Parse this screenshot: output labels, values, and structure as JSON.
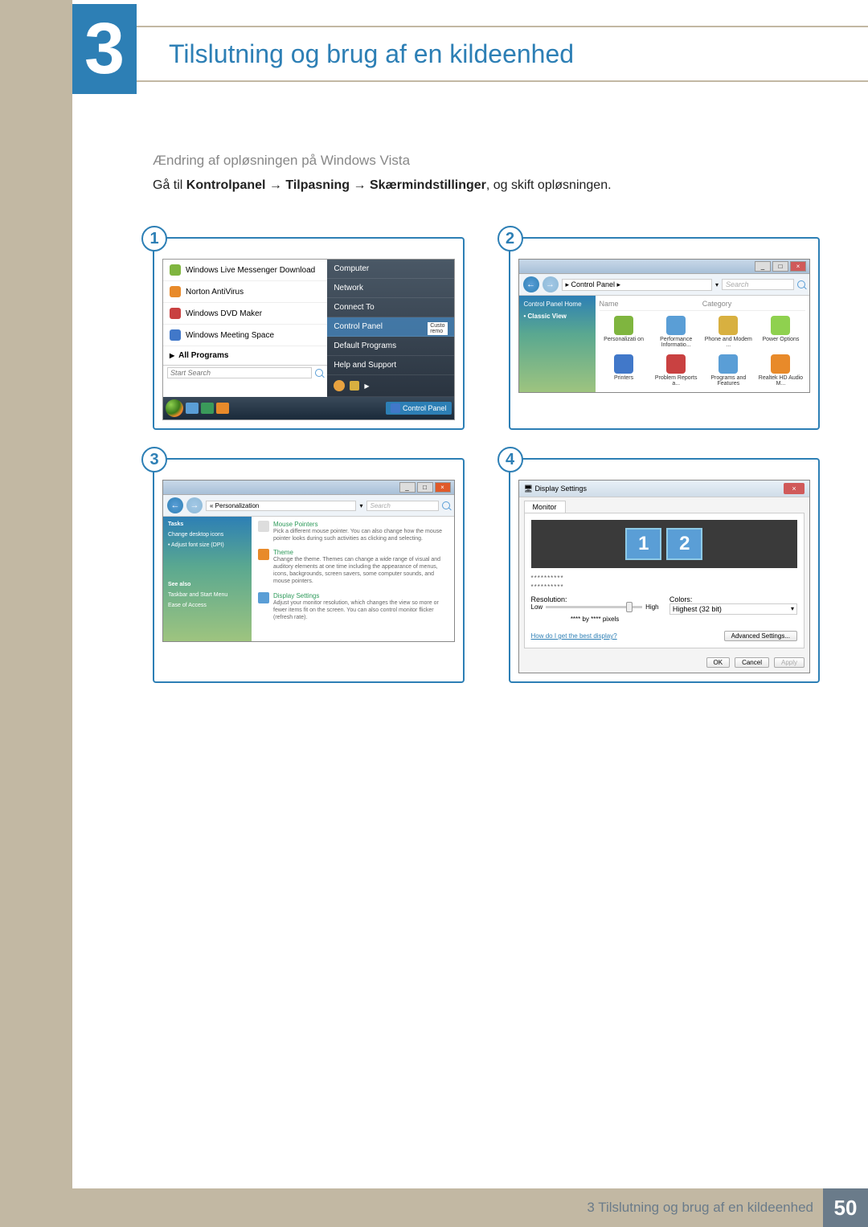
{
  "chapter_number": "3",
  "page_title": "Tilslutning og brug af en kildeenhed",
  "subhead": "Ændring af opløsningen på Windows Vista",
  "body": {
    "prefix": "Gå til ",
    "path1": "Kontrolpanel",
    "arrow": " → ",
    "path2": "Tilpasning",
    "path3": "Skærmindstillinger",
    "suffix": ", og skift opløsningen."
  },
  "shots": {
    "s1": {
      "num": "1"
    },
    "s2": {
      "num": "2"
    },
    "s3": {
      "num": "3"
    },
    "s4": {
      "num": "4"
    }
  },
  "startmenu": {
    "items": [
      "Windows Live Messenger Download",
      "Norton AntiVirus",
      "Windows DVD Maker",
      "Windows Meeting Space"
    ],
    "all_programs": "All Programs",
    "search_placeholder": "Start Search",
    "right": {
      "computer": "Computer",
      "network": "Network",
      "connect": "Connect To",
      "cp": "Control Panel",
      "defprog": "Default Programs",
      "help": "Help and Support",
      "custo": "Custo",
      "remo": "remo"
    },
    "taskbar_label": "Control Panel"
  },
  "cp": {
    "breadcrumb": "▸ Control Panel ▸",
    "search": "Search",
    "sidebar": {
      "home": "Control Panel Home",
      "classic": "Classic View"
    },
    "head_name": "Name",
    "head_cat": "Category",
    "icons": [
      {
        "label": "Personalizati on",
        "color": "#7fb53f"
      },
      {
        "label": "Performance Informatio...",
        "color": "#5a9ed6"
      },
      {
        "label": "Phone and Modem ...",
        "color": "#d8b040"
      },
      {
        "label": "Power Options",
        "color": "#8fd14f"
      },
      {
        "label": "Printers",
        "color": "#4178c9"
      },
      {
        "label": "Problem Reports a...",
        "color": "#c94141"
      },
      {
        "label": "Programs and Features",
        "color": "#5a9ed6"
      },
      {
        "label": "Realtek HD Audio M...",
        "color": "#e88a2a"
      }
    ]
  },
  "pers": {
    "breadcrumb": "« Personalization",
    "search": "Search",
    "sidebar": {
      "tasks": "Tasks",
      "desktop_icons": "Change desktop icons",
      "font_size": "Adjust font size (DPI)",
      "see_also": "See also",
      "taskbar": "Taskbar and Start Menu",
      "ease": "Ease of Access"
    },
    "sections": {
      "mouse_t": "Mouse Pointers",
      "mouse_d": "Pick a different mouse pointer. You can also change how the mouse pointer looks during such activities as clicking and selecting.",
      "theme_t": "Theme",
      "theme_d": "Change the theme. Themes can change a wide range of visual and auditory elements at one time including the appearance of menus, icons, backgrounds, screen savers, some computer sounds, and mouse pointers.",
      "display_t": "Display Settings",
      "display_d": "Adjust your monitor resolution, which changes the view so more or fewer items fit on the screen. You can also control monitor flicker (refresh rate)."
    }
  },
  "disp": {
    "title": "Display Settings",
    "tab": "Monitor",
    "mon1": "1",
    "mon2": "2",
    "name1": "**********",
    "name2": "**********",
    "res_label": "Resolution:",
    "colors_label": "Colors:",
    "low": "Low",
    "high": "High",
    "pixels": "**** by **** pixels",
    "color_value": "Highest (32 bit)",
    "help_link": "How do I get the best display?",
    "advanced": "Advanced Settings...",
    "ok": "OK",
    "cancel": "Cancel",
    "apply": "Apply"
  },
  "footer": {
    "text": "3 Tilslutning og brug af en kildeenhed",
    "page": "50"
  }
}
